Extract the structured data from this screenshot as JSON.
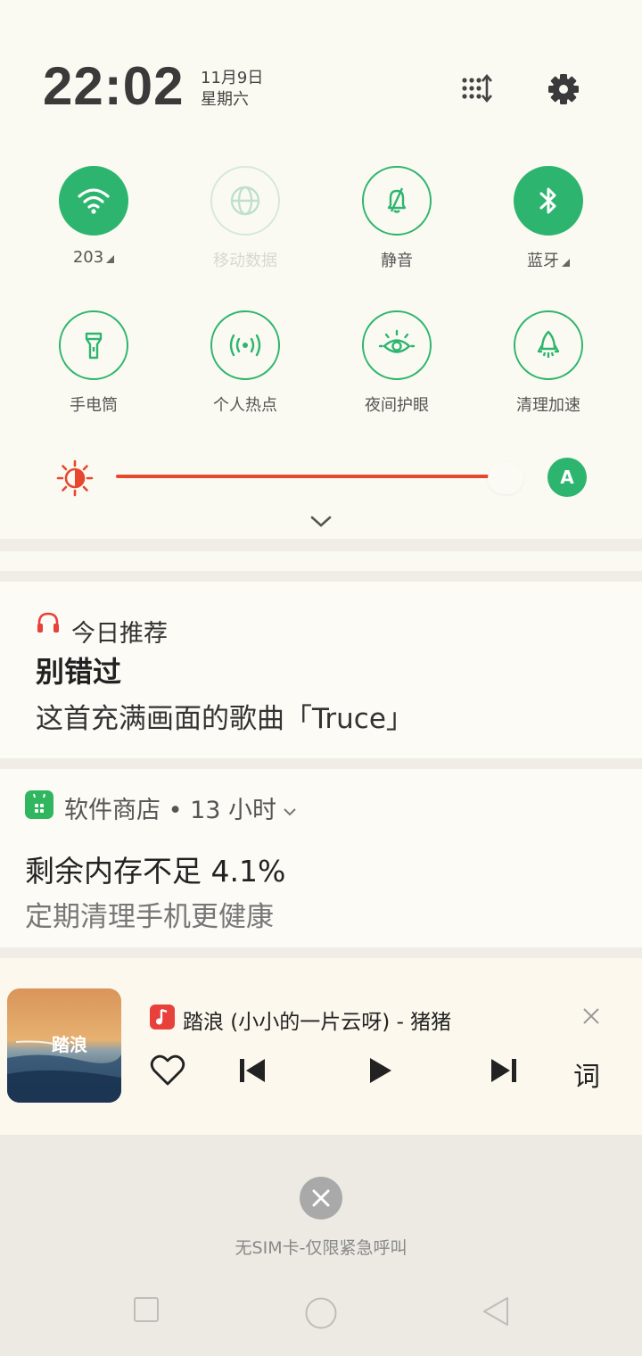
{
  "header": {
    "time": "22:02",
    "date": "11月9日",
    "weekday": "星期六"
  },
  "toggles": [
    {
      "label": "203",
      "icon": "wifi-icon",
      "state": "on",
      "has_arrow": true
    },
    {
      "label": "移动数据",
      "icon": "globe-icon",
      "state": "disabled",
      "has_arrow": false
    },
    {
      "label": "静音",
      "icon": "mute-bell-icon",
      "state": "off",
      "has_arrow": false
    },
    {
      "label": "蓝牙",
      "icon": "bluetooth-icon",
      "state": "on",
      "has_arrow": true
    },
    {
      "label": "手电筒",
      "icon": "flashlight-icon",
      "state": "off",
      "has_arrow": false
    },
    {
      "label": "个人热点",
      "icon": "hotspot-icon",
      "state": "off",
      "has_arrow": false
    },
    {
      "label": "夜间护眼",
      "icon": "eye-icon",
      "state": "off",
      "has_arrow": false
    },
    {
      "label": "清理加速",
      "icon": "rocket-icon",
      "state": "off",
      "has_arrow": false
    }
  ],
  "brightness": {
    "level": 0.97,
    "auto_label": "A"
  },
  "notifications": {
    "recommend": {
      "app": "今日推荐",
      "title": "别错过",
      "body": "这首充满画面的歌曲「Truce」"
    },
    "store": {
      "header": "软件商店 • 13 小时",
      "title": "剩余内存不足 4.1%",
      "body": "定期清理手机更健康"
    }
  },
  "music": {
    "song": "踏浪 (小小的一片云呀) - 猪猪",
    "album_text": "踏浪",
    "lyrics_label": "词"
  },
  "lockscreen": {
    "sim_text": "无SIM卡-仅限紧急呼叫"
  },
  "colors": {
    "accent_green": "#2db56f",
    "brightness_red": "#e8472f",
    "background": "#fbfaf2"
  }
}
